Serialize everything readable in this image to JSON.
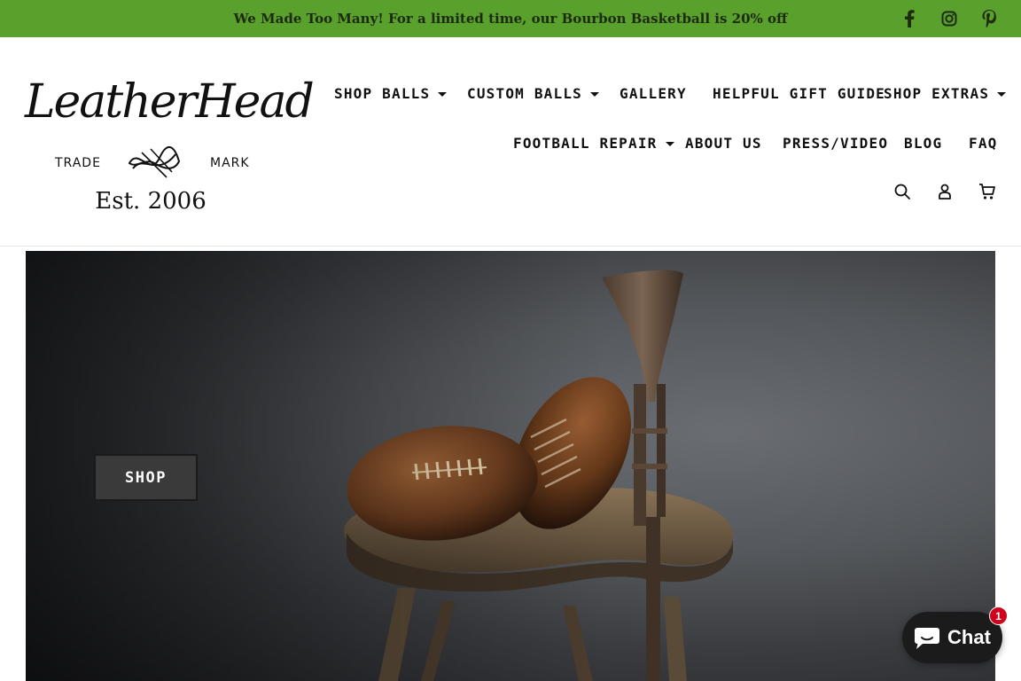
{
  "announcement": {
    "text": "We Made Too Many! For a limited time, our Bourbon Basketball is 20% off",
    "background": "#5aa02c"
  },
  "social": [
    {
      "icon": "facebook-icon"
    },
    {
      "icon": "instagram-icon"
    },
    {
      "icon": "pinterest-icon"
    }
  ],
  "logo": {
    "script": "LeatherHead",
    "left_word": "TRADE",
    "right_word": "MARK",
    "est": "Est. 2006"
  },
  "nav": {
    "row1": [
      {
        "label": "SHOP BALLS",
        "dropdown": true
      },
      {
        "label": "CUSTOM BALLS",
        "dropdown": true
      },
      {
        "label": "GALLERY",
        "dropdown": false
      },
      {
        "label": "HELPFUL GIFT GUIDE",
        "dropdown": false
      },
      {
        "label": "SHOP EXTRAS",
        "dropdown": true
      }
    ],
    "row2": [
      {
        "label": "FOOTBALL REPAIR",
        "dropdown": true
      },
      {
        "label": "ABOUT US",
        "dropdown": false
      },
      {
        "label": "PRESS/VIDEO",
        "dropdown": false
      },
      {
        "label": "BLOG",
        "dropdown": false
      },
      {
        "label": "FAQ",
        "dropdown": false
      }
    ]
  },
  "header_icons": [
    "search-icon",
    "account-icon",
    "cart-icon"
  ],
  "hero": {
    "button_label": "SHOP"
  },
  "chat": {
    "label": "Chat",
    "badge": "1",
    "accent": "#d0021b"
  }
}
